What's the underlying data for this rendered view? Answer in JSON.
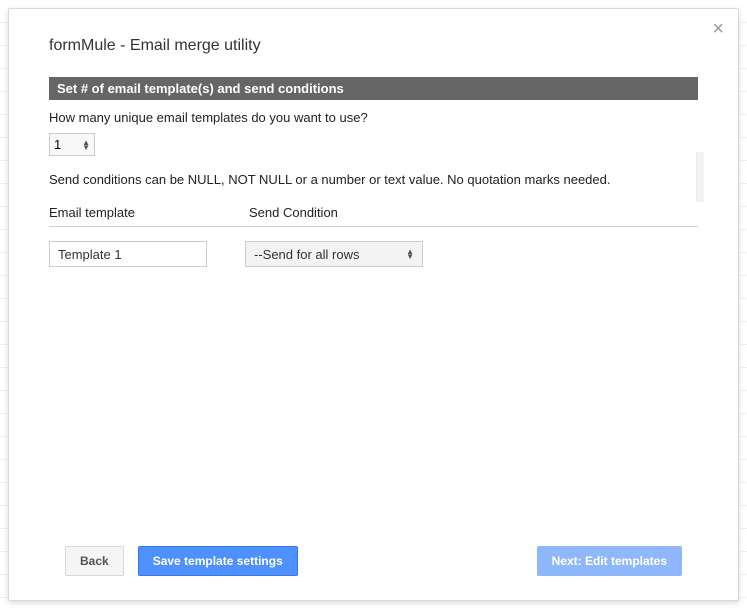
{
  "dialog": {
    "title": "formMule - Email merge utility"
  },
  "section": {
    "header": "Set # of email template(s) and send conditions",
    "prompt": "How many unique email templates do you want to use?",
    "count_value": "1",
    "condition_note": "Send conditions can be NULL, NOT NULL or a number or text value. No quotation marks needed."
  },
  "columns": {
    "template": "Email template",
    "condition": "Send Condition"
  },
  "rows": [
    {
      "template_name": "Template 1",
      "condition_selected": "--Send for all rows"
    }
  ],
  "buttons": {
    "back": "Back",
    "save": "Save template settings",
    "next": "Next: Edit templates"
  }
}
